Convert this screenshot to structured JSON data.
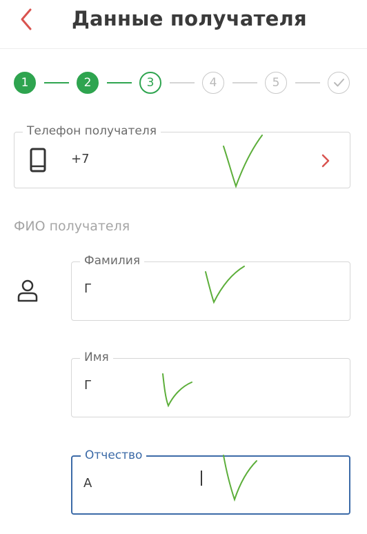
{
  "header": {
    "title": "Данные получателя",
    "back_icon": "chevron-left-icon",
    "accent_color": "#d9534f"
  },
  "stepper": {
    "steps": [
      {
        "label": "1",
        "state": "done"
      },
      {
        "label": "2",
        "state": "done"
      },
      {
        "label": "3",
        "state": "active"
      },
      {
        "label": "4",
        "state": "todo"
      },
      {
        "label": "5",
        "state": "todo"
      },
      {
        "label": "",
        "state": "todo",
        "icon": "checkmark-icon"
      }
    ],
    "done_color": "#2ea44f"
  },
  "phone": {
    "label": "Телефон получателя",
    "value": "+7",
    "icon": "smartphone-icon",
    "chevron_icon": "chevron-right-icon"
  },
  "fio": {
    "section_title": "ФИО получателя",
    "icon": "person-icon",
    "surname": {
      "label": "Фамилия",
      "value": "Г"
    },
    "name": {
      "label": "Имя",
      "value": "Г"
    },
    "patronymic": {
      "label": "Отчество",
      "value": "А"
    }
  },
  "focus_color": "#3b6aa7"
}
